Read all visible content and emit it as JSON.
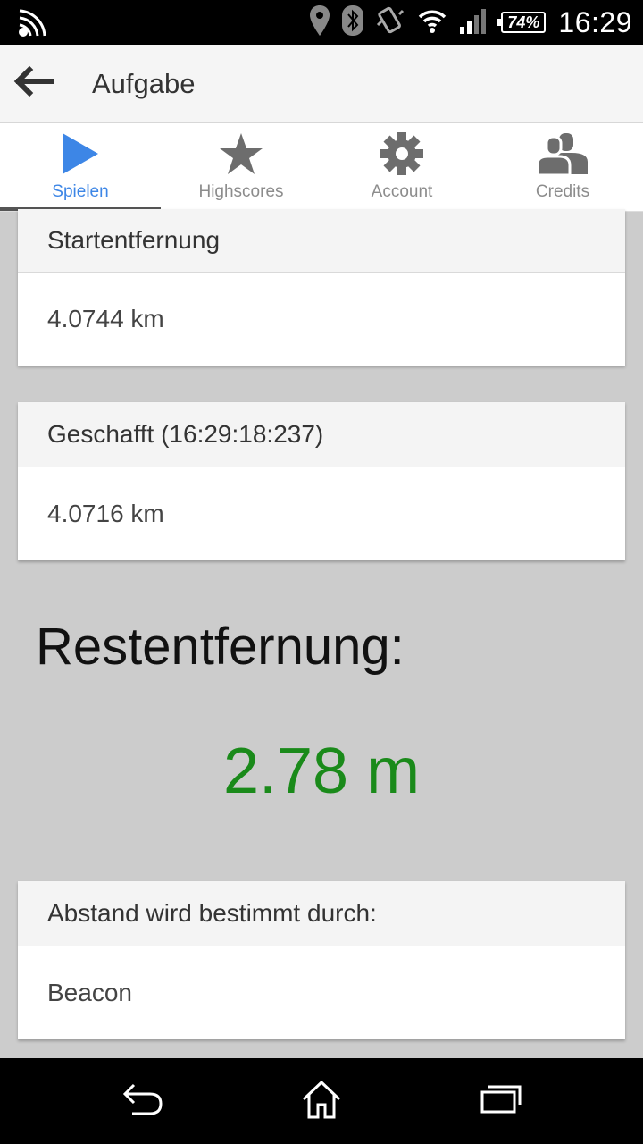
{
  "status_bar": {
    "time": "16:29",
    "battery": "74%",
    "icons": [
      "nfc-icon",
      "location-icon",
      "bluetooth-icon",
      "vibrate-icon",
      "wifi-icon",
      "signal-icon",
      "battery-icon"
    ]
  },
  "action_bar": {
    "title": "Aufgabe",
    "back_icon": "arrow-back-icon"
  },
  "tabs": [
    {
      "label": "Spielen",
      "icon": "play-icon",
      "active": true
    },
    {
      "label": "Highscores",
      "icon": "star-icon",
      "active": false
    },
    {
      "label": "Account",
      "icon": "gear-icon",
      "active": false
    },
    {
      "label": "Credits",
      "icon": "people-icon",
      "active": false
    }
  ],
  "cards": [
    {
      "header": "Startentfernung",
      "value": "4.0744 km"
    },
    {
      "header": "Geschafft (16:29:18:237)",
      "value": "4.0716 km"
    },
    {
      "header": "Abstand wird bestimmt durch:",
      "value": "Beacon"
    }
  ],
  "remaining": {
    "label": "Restentfernung:",
    "value": "2.78 m",
    "value_color": "#1a8a1a"
  },
  "colors": {
    "accent": "#3d86e6",
    "background": "#cccccc"
  },
  "nav_bar": {
    "icons": [
      "back-nav-icon",
      "home-icon",
      "recents-icon"
    ]
  }
}
